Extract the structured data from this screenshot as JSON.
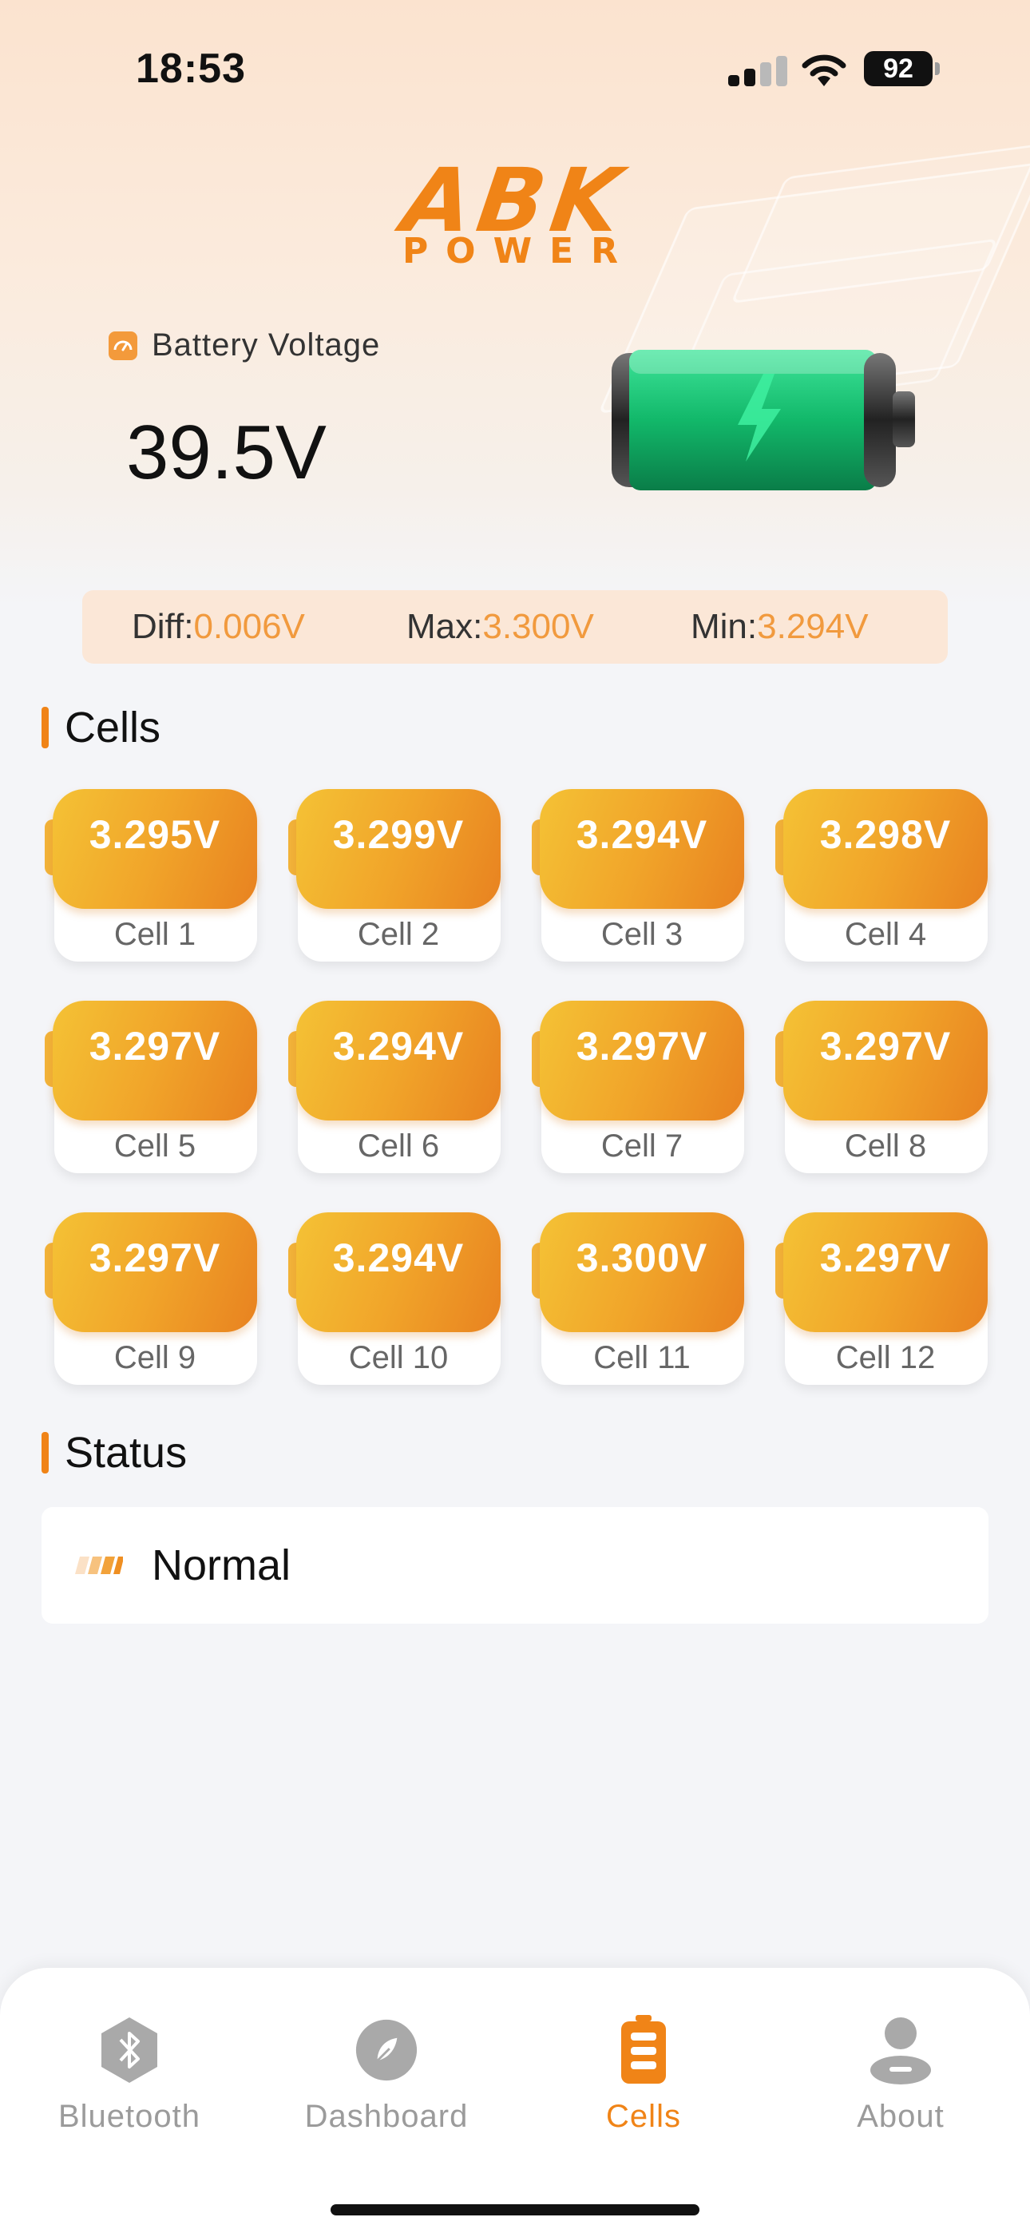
{
  "status_bar": {
    "time": "18:53",
    "battery": "92"
  },
  "logo": {
    "main": "ABK",
    "sub": "POWER"
  },
  "voltage": {
    "label": "Battery Voltage",
    "value": "39.5V"
  },
  "summary": {
    "diff_label": "Diff:",
    "diff_value": "0.006V",
    "max_label": "Max:",
    "max_value": "3.300V",
    "min_label": "Min:",
    "min_value": "3.294V"
  },
  "cells_section": {
    "title": "Cells"
  },
  "cells": [
    {
      "voltage": "3.295V",
      "name": "Cell 1"
    },
    {
      "voltage": "3.299V",
      "name": "Cell 2"
    },
    {
      "voltage": "3.294V",
      "name": "Cell 3"
    },
    {
      "voltage": "3.298V",
      "name": "Cell 4"
    },
    {
      "voltage": "3.297V",
      "name": "Cell 5"
    },
    {
      "voltage": "3.294V",
      "name": "Cell 6"
    },
    {
      "voltage": "3.297V",
      "name": "Cell 7"
    },
    {
      "voltage": "3.297V",
      "name": "Cell 8"
    },
    {
      "voltage": "3.297V",
      "name": "Cell 9"
    },
    {
      "voltage": "3.294V",
      "name": "Cell 10"
    },
    {
      "voltage": "3.300V",
      "name": "Cell 11"
    },
    {
      "voltage": "3.297V",
      "name": "Cell 12"
    }
  ],
  "status_section": {
    "title": "Status",
    "value": "Normal"
  },
  "tabs": [
    {
      "label": "Bluetooth",
      "icon": "bluetooth-icon",
      "active": false
    },
    {
      "label": "Dashboard",
      "icon": "dashboard-icon",
      "active": false
    },
    {
      "label": "Cells",
      "icon": "battery-icon",
      "active": true
    },
    {
      "label": "About",
      "icon": "user-icon",
      "active": false
    }
  ],
  "colors": {
    "accent": "#f08417",
    "value_orange": "#f19a3e",
    "inactive_tab": "#9b9b9b"
  }
}
